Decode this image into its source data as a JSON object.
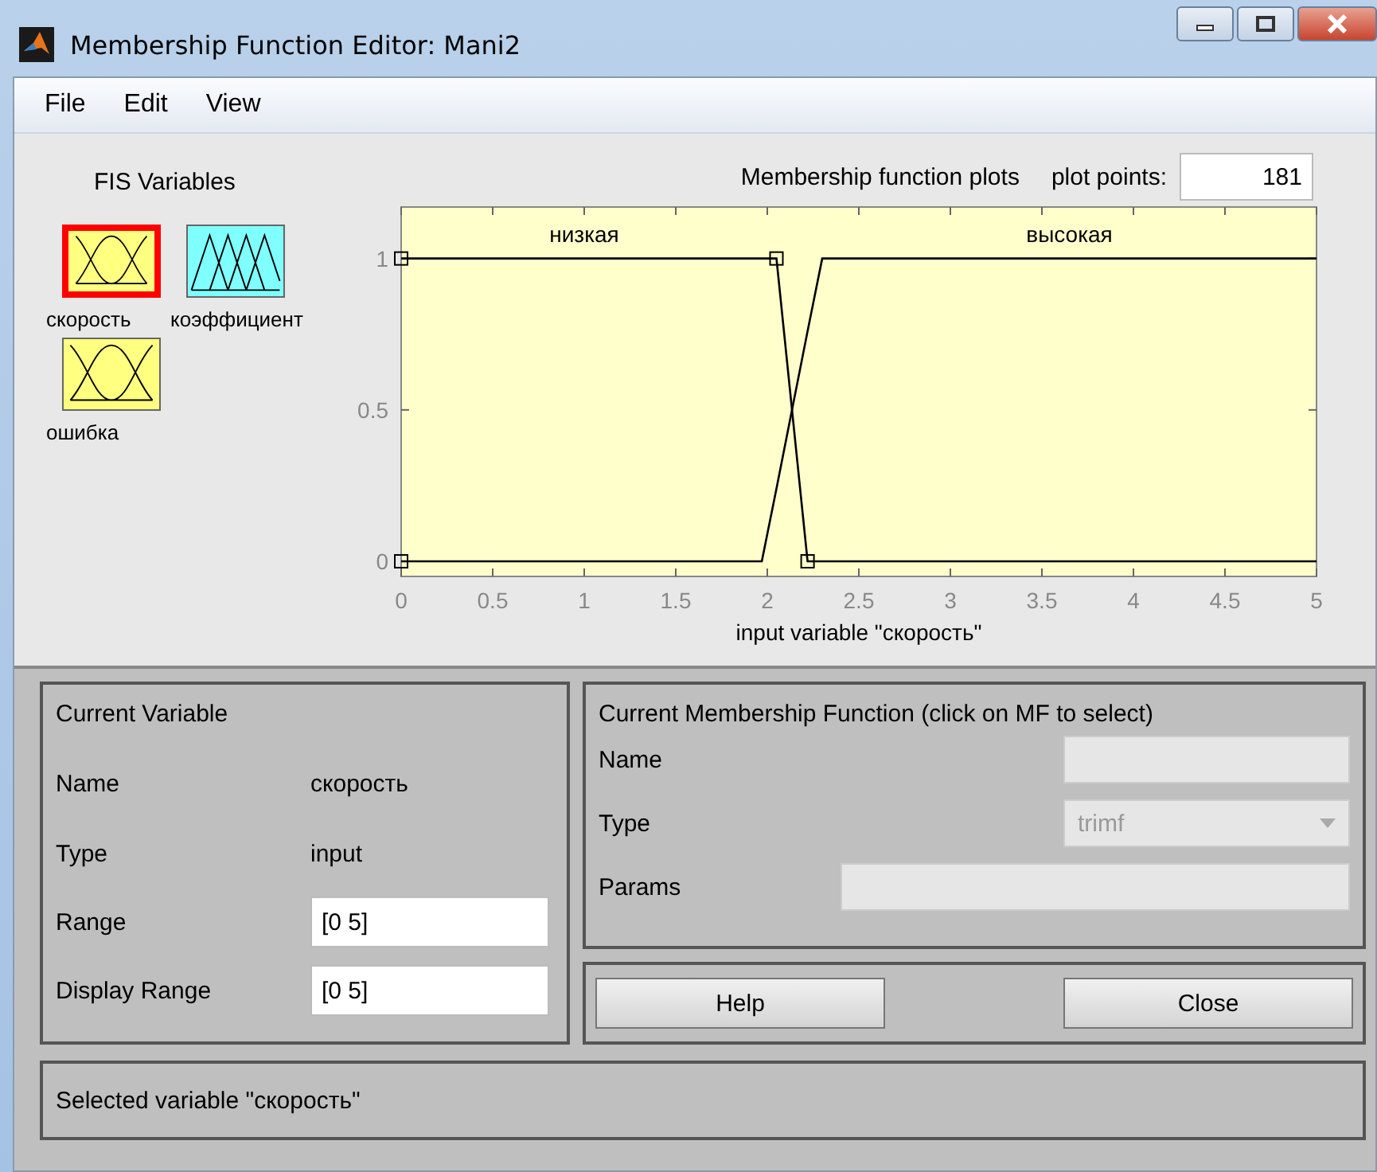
{
  "window": {
    "title": "Membership Function Editor: Mani2"
  },
  "menu": [
    "File",
    "Edit",
    "View"
  ],
  "fis_variables": {
    "title": "FIS Variables",
    "items": [
      {
        "name": "скорость",
        "kind": "input",
        "selected": true
      },
      {
        "name": "коэффициент",
        "kind": "output",
        "selected": false
      },
      {
        "name": "ошибка",
        "kind": "input",
        "selected": false
      }
    ]
  },
  "plot": {
    "title": "Membership function plots",
    "plot_points_label": "plot points:",
    "plot_points": "181",
    "chart_data": {
      "type": "line",
      "xlabel": "input variable \"скорость\"",
      "x": [
        0,
        1.97,
        2.05,
        2.22,
        2.3,
        5
      ],
      "series": [
        {
          "name": "низкая",
          "color": "#000000",
          "values": [
            1,
            1,
            1,
            0,
            0,
            0
          ]
        },
        {
          "name": "высокая",
          "color": "#000000",
          "values": [
            0,
            0,
            0.24,
            0.76,
            1,
            1
          ]
        }
      ],
      "xlim": [
        0,
        5
      ],
      "ylim": [
        -0.05,
        1.17
      ],
      "xticks": [
        0,
        0.5,
        1,
        1.5,
        2,
        2.5,
        3,
        3.5,
        4,
        4.5,
        5
      ],
      "yticks": [
        0,
        0.5,
        1
      ]
    }
  },
  "current_variable": {
    "title": "Current Variable",
    "name_label": "Name",
    "name": "скорость",
    "type_label": "Type",
    "type": "input",
    "range_label": "Range",
    "range": "[0 5]",
    "display_range_label": "Display Range",
    "display_range": "[0 5]"
  },
  "current_mf": {
    "title": "Current Membership Function (click on MF to select)",
    "name_label": "Name",
    "type_label": "Type",
    "type": "trimf",
    "type_disabled": true,
    "params_label": "Params"
  },
  "buttons": [
    "Help",
    "Close"
  ],
  "status": "Selected variable \"скорость\""
}
